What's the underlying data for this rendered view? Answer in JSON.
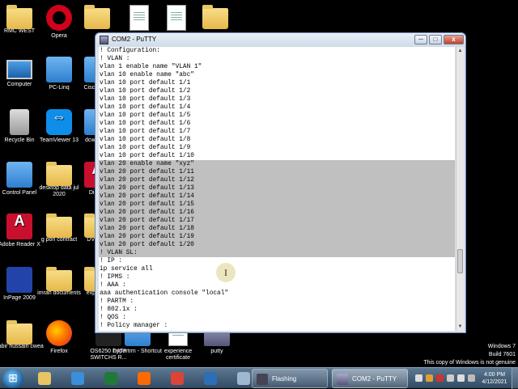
{
  "desktop": {
    "icons": [
      {
        "label": "RMC WEST",
        "icon": "folder-icon"
      },
      {
        "label": "Opera",
        "icon": "opera-icon"
      },
      {
        "label": "",
        "icon": "folder-icon"
      },
      {
        "label": "",
        "icon": "document-icon"
      },
      {
        "label": "",
        "icon": "document-icon"
      },
      {
        "label": "",
        "icon": "folder-icon"
      },
      {
        "label": "Computer",
        "icon": "computer-icon"
      },
      {
        "label": "PC-Linq",
        "icon": "network-icon"
      },
      {
        "label": "Cisco Trac",
        "icon": "app-icon"
      },
      {
        "label": "Recycle Bin",
        "icon": "recycle-bin-icon"
      },
      {
        "label": "TeamViewer 13",
        "icon": "teamviewer-icon"
      },
      {
        "label": "dcw centr",
        "icon": "app-icon"
      },
      {
        "label": "Control Panel",
        "icon": "control-panel-icon"
      },
      {
        "label": "desktop data jul 2020",
        "icon": "folder-icon"
      },
      {
        "label": "Di 202",
        "icon": "app-icon"
      },
      {
        "label": "Adobe Reader X",
        "icon": "pdf-icon"
      },
      {
        "label": "g pon contract",
        "icon": "folder-icon"
      },
      {
        "label": "DV TEE",
        "icon": "app-icon"
      },
      {
        "label": "InPage 2009",
        "icon": "inpage-icon"
      },
      {
        "label": "imran documents",
        "icon": "folder-icon"
      },
      {
        "label": "exp cent",
        "icon": "app-icon"
      },
      {
        "label": "sabir hussain cwea",
        "icon": "folder-icon"
      },
      {
        "label": "Firefox",
        "icon": "firefox-icon"
      },
      {
        "label": "OS6250 DATA SWITCHS R...",
        "icon": "ubuntu-icon"
      },
      {
        "label": "hypertrm - Shortcut",
        "icon": "hyperterminal-icon"
      },
      {
        "label": "experience certificate",
        "icon": "document-icon"
      },
      {
        "label": "putty",
        "icon": "putty-icon"
      }
    ]
  },
  "putty": {
    "title": "COM2 - PuTTY",
    "minimize": "─",
    "maximize": "□",
    "close": "x",
    "lines": [
      {
        "text": "! Configuration:",
        "sel": false
      },
      {
        "text": "! VLAN :",
        "sel": false
      },
      {
        "text": "vlan 1 enable name \"VLAN 1\"",
        "sel": false
      },
      {
        "text": "vlan 10 enable name \"abc\"",
        "sel": false
      },
      {
        "text": "vlan 10 port default 1/1",
        "sel": false
      },
      {
        "text": "vlan 10 port default 1/2",
        "sel": false
      },
      {
        "text": "vlan 10 port default 1/3",
        "sel": false
      },
      {
        "text": "vlan 10 port default 1/4",
        "sel": false
      },
      {
        "text": "vlan 10 port default 1/5",
        "sel": false
      },
      {
        "text": "vlan 10 port default 1/6",
        "sel": false
      },
      {
        "text": "vlan 10 port default 1/7",
        "sel": false
      },
      {
        "text": "vlan 10 port default 1/8",
        "sel": false
      },
      {
        "text": "vlan 10 port default 1/9",
        "sel": false
      },
      {
        "text": "vlan 10 port default 1/10",
        "sel": false
      },
      {
        "text": "vlan 20 enable name \"xyz\"",
        "sel": true
      },
      {
        "text": "vlan 20 port default 1/11",
        "sel": true
      },
      {
        "text": "vlan 20 port default 1/12",
        "sel": true
      },
      {
        "text": "vlan 20 port default 1/13",
        "sel": true
      },
      {
        "text": "vlan 20 port default 1/14",
        "sel": true
      },
      {
        "text": "vlan 20 port default 1/15",
        "sel": true
      },
      {
        "text": "vlan 20 port default 1/16",
        "sel": true
      },
      {
        "text": "vlan 20 port default 1/17",
        "sel": true
      },
      {
        "text": "vlan 20 port default 1/18",
        "sel": true
      },
      {
        "text": "vlan 20 port default 1/19",
        "sel": true
      },
      {
        "text": "vlan 20 port default 1/20",
        "sel": true
      },
      {
        "text": "! VLAN SL:",
        "sel": true
      },
      {
        "text": "! IP :",
        "sel": false
      },
      {
        "text": "ip service all",
        "sel": false
      },
      {
        "text": "! IPMS :",
        "sel": false
      },
      {
        "text": "! AAA :",
        "sel": false
      },
      {
        "text": "aaa authentication console \"local\"",
        "sel": false
      },
      {
        "text": "! PARTM :",
        "sel": false
      },
      {
        "text": "! 802.1x :",
        "sel": false
      },
      {
        "text": "! QOS :",
        "sel": false
      },
      {
        "text": "! Policy manager :",
        "sel": false
      }
    ],
    "cursor_glyph": "I"
  },
  "watermark": {
    "line1": "Windows 7",
    "line2": "Build 7601",
    "line3": "This copy of Windows is not genuine"
  },
  "taskbar": {
    "pinned": [
      {
        "name": "explorer-icon",
        "color": "#e8c463"
      },
      {
        "name": "ie-icon",
        "color": "#3a8fd8"
      },
      {
        "name": "excel-icon",
        "color": "#1f7a3a"
      },
      {
        "name": "firefox-icon",
        "color": "#ff6a00"
      },
      {
        "name": "chrome-icon",
        "color": "#db4437"
      },
      {
        "name": "app-icon",
        "color": "#2d6fb7"
      },
      {
        "name": "notepad-icon",
        "color": "#9fb8d0"
      }
    ],
    "tasks": [
      {
        "label": "Flashing",
        "name": "task-flashing",
        "color": "#445"
      },
      {
        "label": "COM2 - PuTTY",
        "name": "task-putty",
        "color": "#8899bb"
      }
    ],
    "time": "4:00 PM",
    "date": "4/12/2021"
  }
}
